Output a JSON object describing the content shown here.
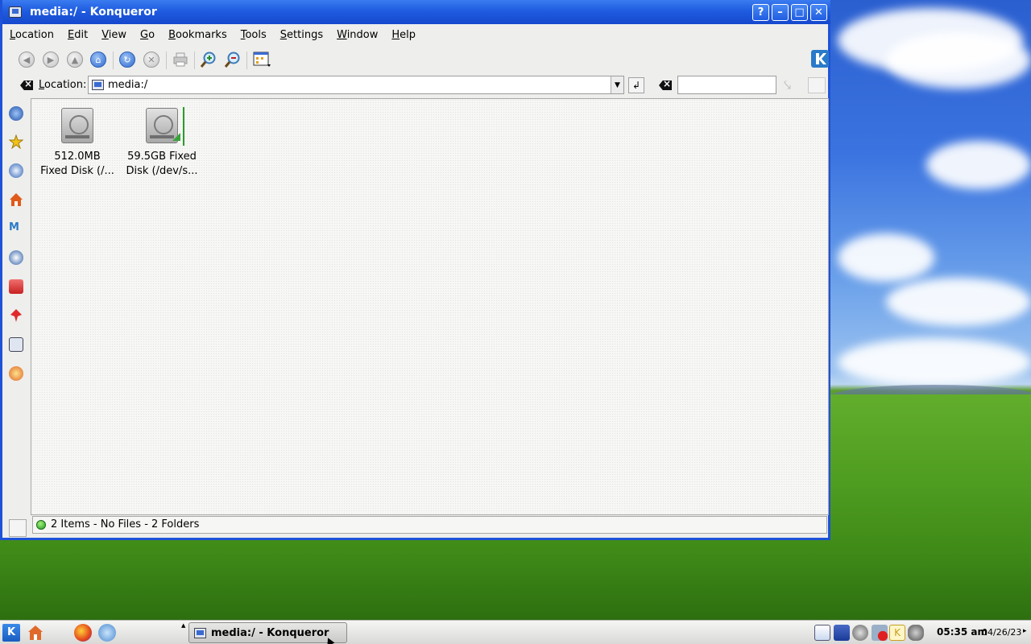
{
  "window": {
    "title": "media:/ - Konqueror",
    "buttons": {
      "help": "?",
      "minimize": "–",
      "maximize": "□",
      "close": "✕"
    }
  },
  "menu": [
    {
      "first": "L",
      "rest": "ocation"
    },
    {
      "first": "E",
      "rest": "dit"
    },
    {
      "first": "V",
      "rest": "iew"
    },
    {
      "first": "G",
      "rest": "o"
    },
    {
      "first": "B",
      "rest": "ookmarks"
    },
    {
      "first": "T",
      "rest": "ools"
    },
    {
      "first": "S",
      "rest": "ettings"
    },
    {
      "first": "W",
      "rest": "indow"
    },
    {
      "first": "H",
      "rest": "elp"
    }
  ],
  "toolbar": {
    "icons": [
      "back-icon",
      "forward-icon",
      "up-icon",
      "home-icon",
      "reload-icon",
      "stop-icon",
      "print-icon",
      "zoom-in-icon",
      "zoom-out-icon",
      "view-mode-icon"
    ]
  },
  "location": {
    "label_first": "L",
    "label_rest": "ocation:",
    "value": "media:/",
    "search_value": ""
  },
  "files": [
    {
      "line1": "512.0MB",
      "line2": "Fixed Disk (/..."
    },
    {
      "line1": "59.5GB Fixed",
      "line2": "Disk (/dev/s..."
    }
  ],
  "status": {
    "text": "2 Items - No Files - 2 Folders"
  },
  "taskbar": {
    "task_label": "media:/ - Konqueror",
    "clock": "05:35 am",
    "date": "04/26/23"
  },
  "colors": {
    "titlebar": "#1f5ce0",
    "window_bg": "#eeeeec",
    "status_led": "#1e9b23"
  }
}
